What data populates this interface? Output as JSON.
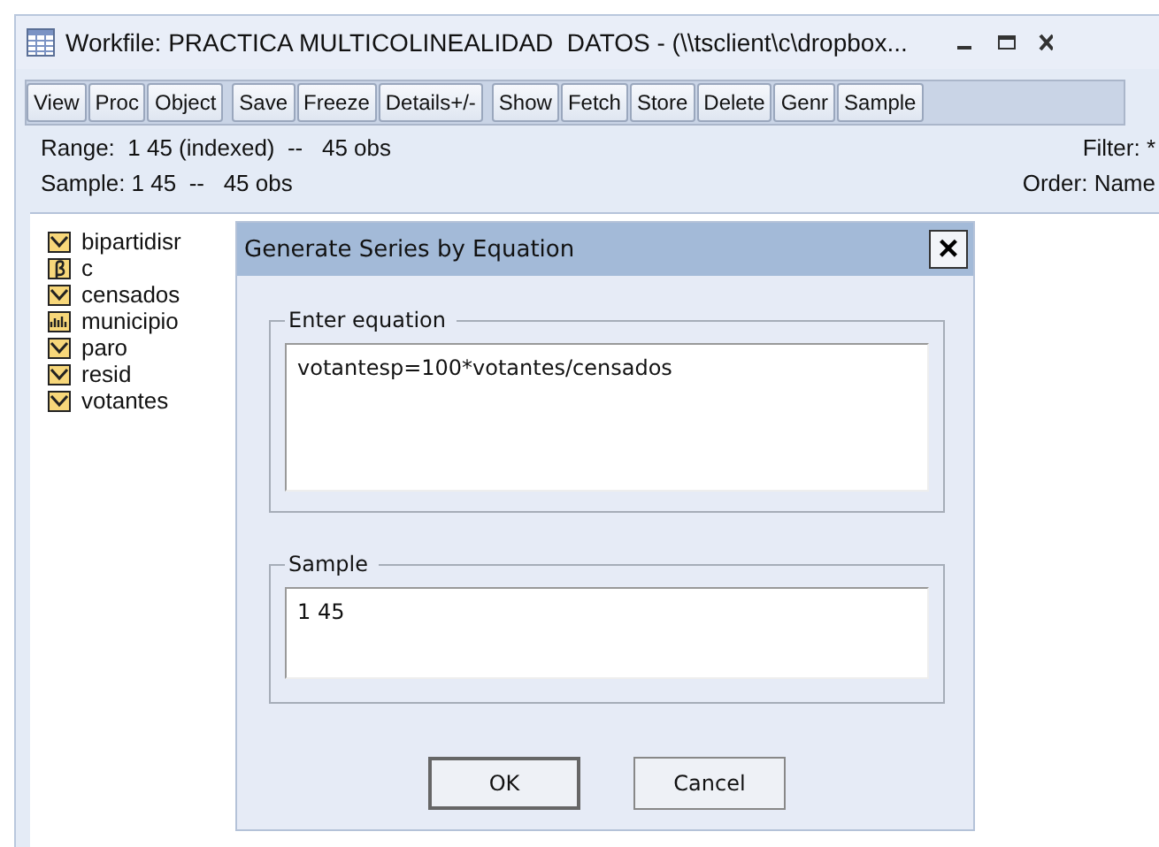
{
  "window": {
    "title": "Workfile: PRACTICA MULTICOLINEALIDAD  DATOS - (\\\\tsclient\\c\\dropbox..."
  },
  "toolbar": [
    [
      "View",
      "Proc",
      "Object"
    ],
    [
      "Save",
      "Freeze",
      "Details+/-"
    ],
    [
      "Show",
      "Fetch",
      "Store",
      "Delete",
      "Genr",
      "Sample"
    ]
  ],
  "info": {
    "range": "Range:  1 45 (indexed)  --   45 obs",
    "sample": "Sample: 1 45  --   45 obs",
    "filter": "Filter: *",
    "order": "Order: Name"
  },
  "objects": [
    {
      "kind": "series",
      "name": "bipartidisr"
    },
    {
      "kind": "coef",
      "name": "c"
    },
    {
      "kind": "series",
      "name": "censados"
    },
    {
      "kind": "alpha",
      "name": "municipio"
    },
    {
      "kind": "series",
      "name": "paro"
    },
    {
      "kind": "series",
      "name": "resid"
    },
    {
      "kind": "series",
      "name": "votantes"
    }
  ],
  "dialog": {
    "title": "Generate Series by Equation",
    "close": "×",
    "equation_label": "Enter equation",
    "equation": "votantesp=100*votantes/censados",
    "sample_label": "Sample",
    "sample": "1 45",
    "buttons": [
      "OK",
      "Cancel"
    ]
  }
}
